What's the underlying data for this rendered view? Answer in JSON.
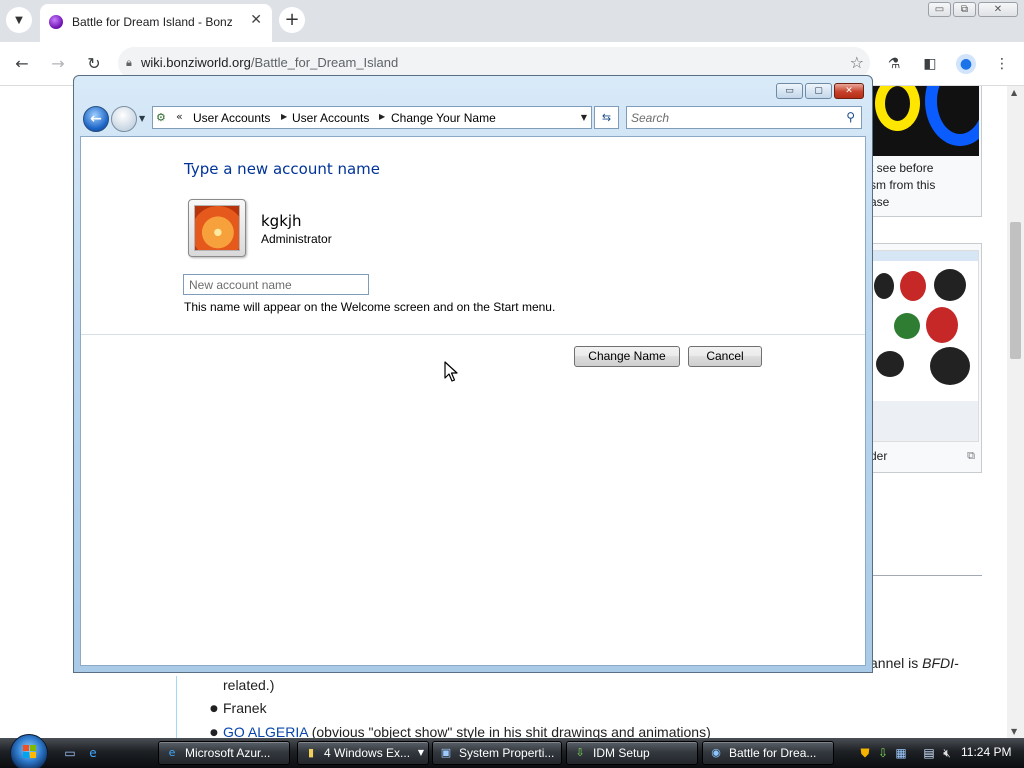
{
  "browser": {
    "tab": {
      "title": "Battle for Dream Island - BonziWorld",
      "close": "✕"
    },
    "new_tab": "+",
    "window_controls": [
      "▭",
      "⧉",
      "✕"
    ],
    "nav": {
      "back": "←",
      "forward": "→",
      "reload": "↻"
    },
    "url": {
      "host": "wiki.bonziworld.org",
      "path": "/Battle_for_Dream_Island"
    },
    "icons": {
      "tab_search": "chevron-down-icon",
      "lock": "lock-icon",
      "star": "star-icon",
      "labs": "flask-icon",
      "side_panel": "side-panel-icon",
      "profile": "profile-icon",
      "menu": "kebab-menu-icon"
    }
  },
  "wiki": {
    "infobox_top_caption": [
      "t see before",
      "sm from this",
      "ase"
    ],
    "infobox_mid_caption": "der",
    "channel_text_prefix": "annel is ",
    "channel_text_italic": "BFDI-",
    "related_text": "related.)",
    "list_items": [
      {
        "text": "Franek",
        "link": "",
        "suffix": ""
      },
      {
        "text": "",
        "link": "GO ALGERIA",
        "suffix": " (obvious \"object show\" style in his shit drawings and animations)"
      }
    ]
  },
  "dialog": {
    "breadcrumb": [
      "User Accounts",
      "User Accounts",
      "Change Your Name"
    ],
    "search_placeholder": "Search",
    "heading": "Type a new account name",
    "account_name": "kgkjh",
    "account_type": "Administrator",
    "new_name_placeholder": "New account name",
    "new_name_value": "",
    "hint": "This name will appear on the Welcome screen and on the Start menu.",
    "change_name_label": "Change Name",
    "cancel_label": "Cancel",
    "caption_buttons": [
      "▭",
      "▢",
      "✕"
    ],
    "accent_color": "#003399"
  },
  "taskbar": {
    "tasks": [
      {
        "label": "Microsoft Azur...",
        "icon": "ie-icon"
      },
      {
        "label": "4 Windows Ex...",
        "icon": "folder-icon"
      },
      {
        "label": "System Properti...",
        "icon": "system-properties-icon"
      },
      {
        "label": "IDM Setup",
        "icon": "idm-icon"
      },
      {
        "label": "Battle for Drea...",
        "icon": "chrome-icon"
      }
    ],
    "clock": "11:24 PM"
  }
}
